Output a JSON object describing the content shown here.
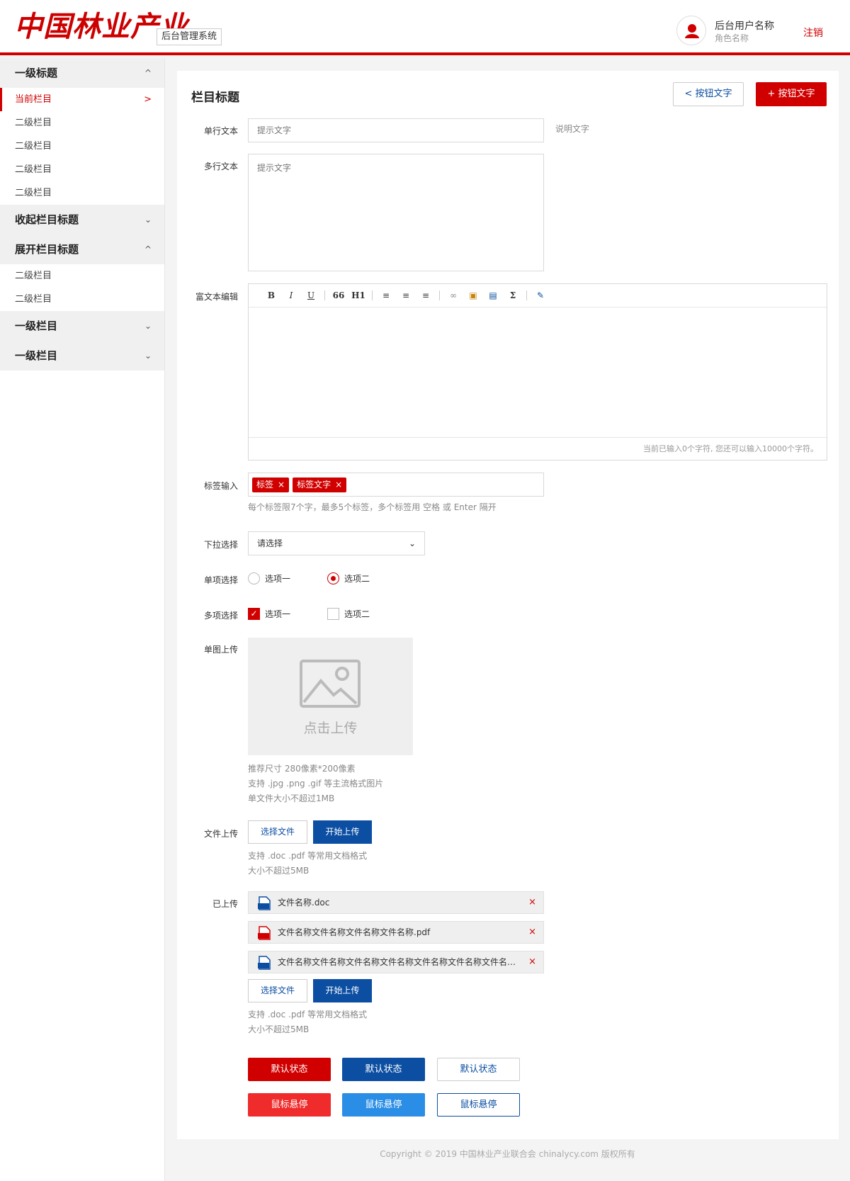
{
  "header": {
    "logo": "中国林业产业",
    "system_name": "后台管理系统",
    "user_name": "后台用户名称",
    "user_role": "角色名称",
    "logout": "注销",
    "accent_color": "#d10000"
  },
  "sidebar": {
    "groups": [
      {
        "label": "一级标题",
        "chevron": "^",
        "items": [
          "当前栏目",
          "二级栏目",
          "二级栏目",
          "二级栏目",
          "二级栏目"
        ]
      },
      {
        "label": "收起栏目标题",
        "chevron": "⌄"
      },
      {
        "label": "展开栏目标题",
        "chevron": "^",
        "items": [
          "二级栏目",
          "二级栏目"
        ]
      },
      {
        "label": "一级栏目",
        "chevron": "⌄"
      },
      {
        "label": "一级栏目",
        "chevron": "⌄"
      }
    ],
    "active_arrow": ">"
  },
  "main": {
    "title": "栏目标题",
    "back_button": "按钮文字",
    "back_icon": "<",
    "add_button": "按钮文字",
    "add_icon": "+"
  },
  "form": {
    "single_line": {
      "label": "单行文本",
      "placeholder": "提示文字",
      "note": "说明文字"
    },
    "multi_line": {
      "label": "多行文本",
      "placeholder": "提示文字"
    },
    "rich_text": {
      "label": "富文本编辑",
      "toolbar": [
        "B",
        "I",
        "U",
        "66",
        "H1",
        "≡",
        "≡",
        "≡",
        "∞",
        "▣",
        "▤",
        "Σ",
        "✎"
      ],
      "status": "当前已输入0个字符, 您还可以输入10000个字符。"
    },
    "tags": {
      "label": "标签输入",
      "items": [
        "标签",
        "标签文字"
      ],
      "remove": "×",
      "hint": "每个标签限7个字，最多5个标签，多个标签用 空格 或 Enter 隔开"
    },
    "dropdown": {
      "label": "下拉选择",
      "value": "请选择",
      "caret": "⌄"
    },
    "radio": {
      "label": "单项选择",
      "options": [
        "选项一",
        "选项二"
      ],
      "selected": 1
    },
    "checkbox": {
      "label": "多项选择",
      "options": [
        "选项一",
        "选项二"
      ],
      "checked": [
        0
      ],
      "check_mark": "✓"
    },
    "image_upload": {
      "label": "单图上传",
      "text": "点击上传",
      "hints": [
        "推荐尺寸 280像素*200像素",
        "支持 .jpg .png .gif 等主流格式图片",
        "单文件大小不超过1MB"
      ]
    },
    "file_upload": {
      "label": "文件上传",
      "choose": "选择文件",
      "start": "开始上传",
      "hints": [
        "支持 .doc .pdf 等常用文档格式",
        "大小不超过5MB"
      ]
    },
    "uploaded": {
      "label": "已上传",
      "files": [
        {
          "name": "文件名称.doc",
          "type": "DOC"
        },
        {
          "name": "文件名称文件名称文件名称文件名称.pdf",
          "type": "PDF"
        },
        {
          "name": "文件名称文件名称文件名称文件名称文件名称文件名称文件名称...",
          "type": "DOC"
        }
      ],
      "remove": "×",
      "choose": "选择文件",
      "start": "开始上传",
      "hints": [
        "支持 .doc .pdf 等常用文档格式",
        "大小不超过5MB"
      ]
    },
    "states": {
      "default": "默认状态",
      "hover": "鼠标悬停",
      "colors": {
        "red": "#d10000",
        "red_hover": "#f02b2b",
        "blue": "#0b4ea2",
        "blue_hover": "#2a8ee6"
      }
    }
  },
  "footer": {
    "copyright": "Copyright © 2019 中国林业产业联合会 chinalycy.com 版权所有"
  }
}
